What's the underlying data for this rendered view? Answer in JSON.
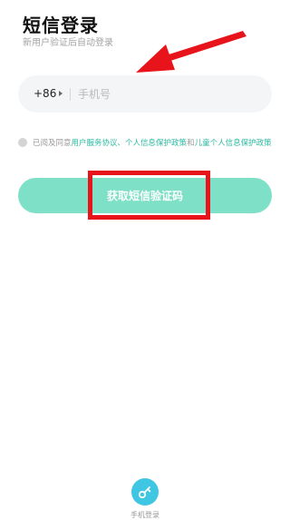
{
  "header": {
    "title": "短信登录",
    "subtitle": "新用户验证后自动登录"
  },
  "phone": {
    "country_code": "+86",
    "placeholder": "手机号",
    "value": ""
  },
  "agreement": {
    "prefix": "已阅及同意",
    "link_service": "用户服务协议",
    "sep1": "、",
    "link_privacy": "个人信息保护政策",
    "and": "和",
    "link_children": "儿童个人信息保护政策",
    "checked": false
  },
  "cta": {
    "label": "获取短信验证码",
    "color": "#7ee0c6"
  },
  "alt_login": {
    "label": "手机登录",
    "icon": "key-icon",
    "color": "#3ec6e3"
  },
  "annotations": {
    "arrow_color": "#e8141c",
    "box_color": "#e8141c"
  }
}
